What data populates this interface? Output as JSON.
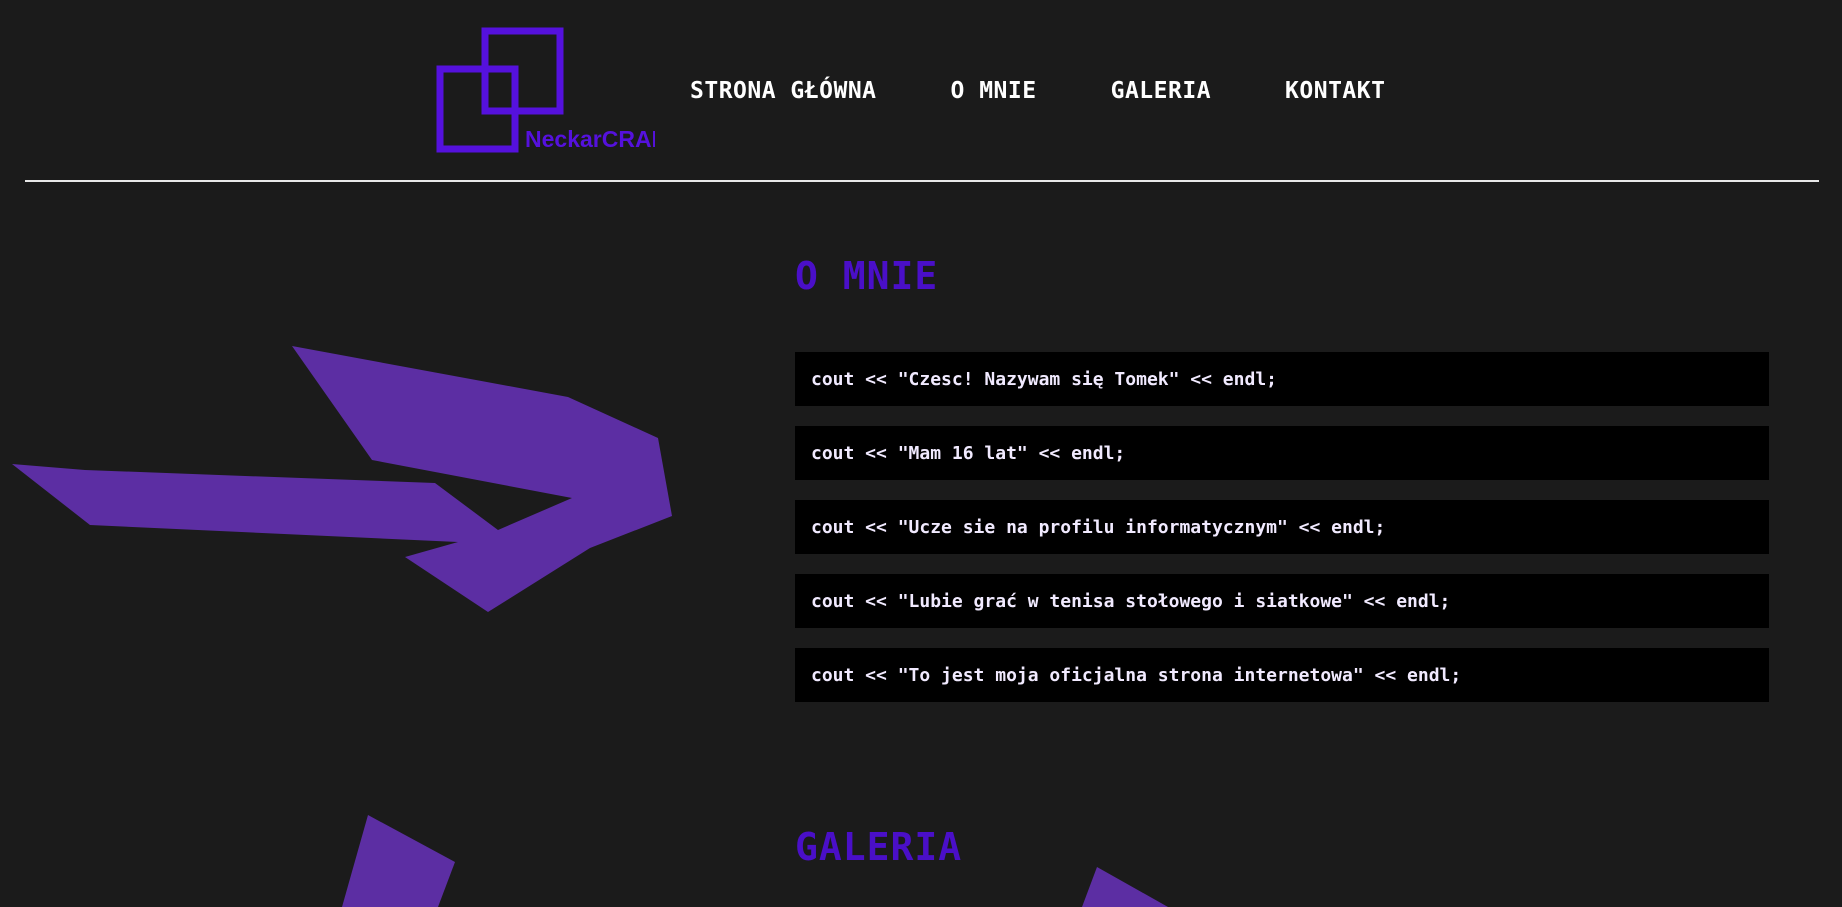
{
  "logo": {
    "text": "NeckarCRAFT",
    "color": "#5511dd"
  },
  "nav": {
    "items": [
      {
        "label": "STRONA GŁÓWNA"
      },
      {
        "label": "O MNIE"
      },
      {
        "label": "GALERIA"
      },
      {
        "label": "KONTAKT"
      }
    ]
  },
  "about": {
    "title": "O MNIE",
    "lines": [
      "cout << \"Czesc! Nazywam się Tomek\" << endl;",
      "cout << \"Mam 16 lat\" << endl;",
      "cout << \"Ucze sie na profilu informatycznym\" << endl;",
      "cout << \"Lubie grać w tenisa stołowego i siatkowe\" << endl;",
      "cout << \"To jest moja oficjalna strona internetowa\" << endl;"
    ]
  },
  "gallery": {
    "title": "GALERIA"
  },
  "colors": {
    "background": "#1b1b1b",
    "accent": "#4a0fc8",
    "arrow": "#5c2ea3",
    "code_bg": "#000000"
  }
}
